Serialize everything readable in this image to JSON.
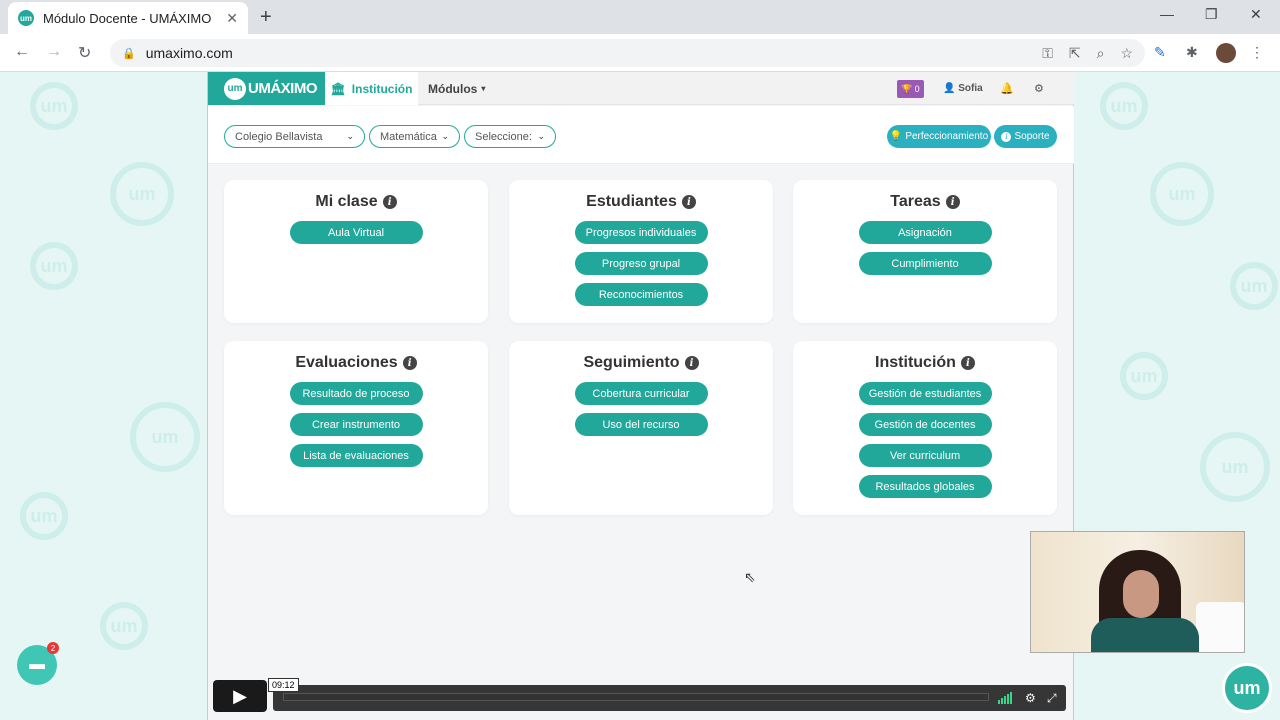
{
  "browser": {
    "tab_title": "Módulo Docente - UMÁXIMO",
    "favicon_text": "um",
    "url": "umaximo.com"
  },
  "app": {
    "logo_badge": "um",
    "logo_text": "UMÁXIMO",
    "nav": {
      "institucion": "Institución",
      "modulos": "Módulos",
      "badge_count": "0",
      "user": "Sofia"
    },
    "filters": {
      "school": "Colegio Bellavista",
      "subject": "Matemática",
      "select": "Seleccione:"
    },
    "actions": {
      "perfeccionamiento": "Perfeccionamiento",
      "soporte": "Soporte"
    },
    "cards": [
      {
        "title": "Mi clase",
        "buttons": [
          "Aula Virtual"
        ]
      },
      {
        "title": "Estudiantes",
        "buttons": [
          "Progresos individuales",
          "Progreso grupal",
          "Reconocimientos"
        ]
      },
      {
        "title": "Tareas",
        "buttons": [
          "Asignación",
          "Cumplimiento"
        ]
      },
      {
        "title": "Evaluaciones",
        "buttons": [
          "Resultado de proceso",
          "Crear instrumento",
          "Lista de evaluaciones"
        ]
      },
      {
        "title": "Seguimiento",
        "buttons": [
          "Cobertura curricular",
          "Uso del recurso"
        ]
      },
      {
        "title": "Institución",
        "buttons": [
          "Gestión de estudiantes",
          "Gestión de docentes",
          "Ver curriculum",
          "Resultados globales"
        ]
      }
    ]
  },
  "video": {
    "timestamp": "09:12"
  },
  "chat": {
    "badge": "2"
  },
  "corner_logo": "um",
  "colors": {
    "primary": "#22a89a",
    "accent": "#2ab0bf",
    "badge": "#9b59b6"
  }
}
